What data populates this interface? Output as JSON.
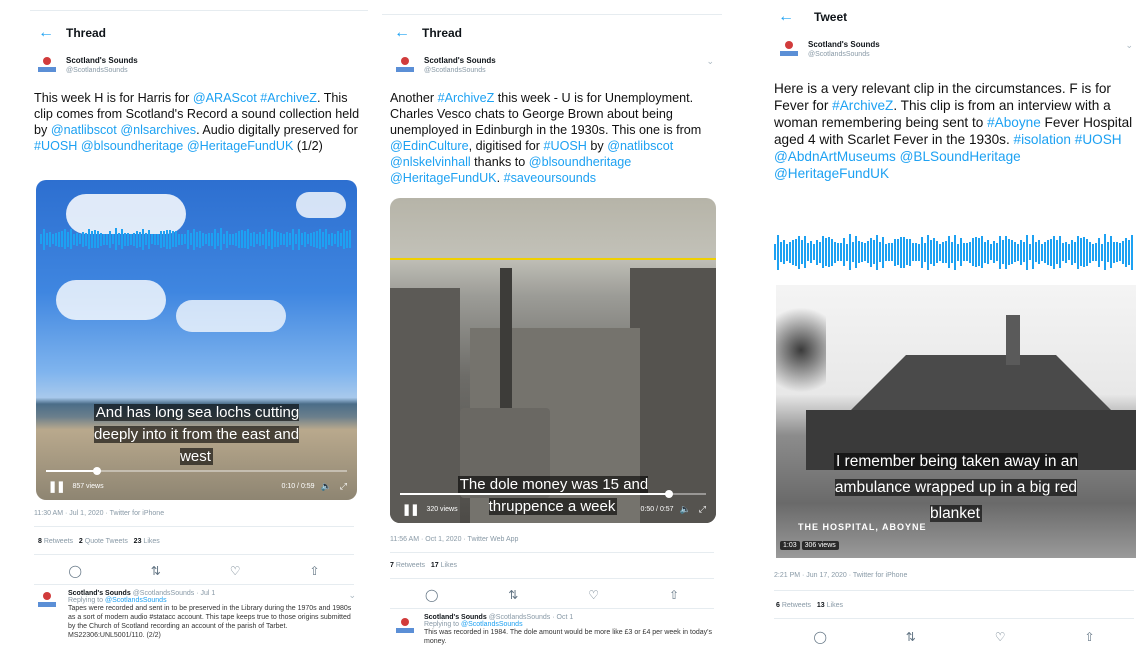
{
  "panels": [
    {
      "header": "Thread",
      "author": {
        "name": "Scotland's Sounds",
        "handle": "@ScotlandsSounds"
      },
      "tweet": {
        "parts": [
          {
            "t": "This week H is for Harris for "
          },
          {
            "t": "@ARAScot",
            "link": true
          },
          {
            "t": " "
          },
          {
            "t": "#ArchiveZ",
            "link": true
          },
          {
            "t": ".  This clip comes from Scotland's Record a sound collection held by "
          },
          {
            "t": "@natlibscot",
            "link": true
          },
          {
            "t": " "
          },
          {
            "t": "@nlsarchives",
            "link": true
          },
          {
            "t": ". Audio digitally preserved for "
          },
          {
            "t": "#UOSH",
            "link": true
          },
          {
            "t": " "
          },
          {
            "t": "@blsoundheritage",
            "link": true
          },
          {
            "t": " "
          },
          {
            "t": "@HeritageFundUK",
            "link": true
          },
          {
            "t": " (1/2)"
          }
        ]
      },
      "video": {
        "subtitle": "And has long sea lochs cutting deeply into it from the east and west",
        "views": "857 views",
        "time": "0:10 / 0:59",
        "progress": 0.17
      },
      "meta": "11:30 AM · Jul 1, 2020 · Twitter for iPhone",
      "stats": [
        {
          "num": "8",
          "label": "Retweets"
        },
        {
          "num": "2",
          "label": "Quote Tweets"
        },
        {
          "num": "23",
          "label": "Likes"
        }
      ],
      "reply": {
        "name": "Scotland's Sounds",
        "handle": "@ScotlandsSounds · Jul 1",
        "replying_to_label": "Replying to",
        "replying_to": "@ScotlandsSounds",
        "text": "Tapes were recorded and sent in to be preserved in the Library during the 1970s and 1980s as a sort of modern audio #statacc account. This tape keeps true to those origins submitted by the Church of Scotland recording an account of the parish of Tarbet. MS22306:UNL5001/110. (2/2)"
      }
    },
    {
      "header": "Thread",
      "author": {
        "name": "Scotland's Sounds",
        "handle": "@ScotlandsSounds"
      },
      "tweet": {
        "parts": [
          {
            "t": "Another "
          },
          {
            "t": "#ArchiveZ",
            "link": true
          },
          {
            "t": " this week - U is for Unemployment. Charles Vesco chats to George Brown about being unemployed in Edinburgh in the 1930s. This one is from "
          },
          {
            "t": "@EdinCulture",
            "link": true
          },
          {
            "t": ",  digitised for "
          },
          {
            "t": "#UOSH",
            "link": true
          },
          {
            "t": " by "
          },
          {
            "t": "@natlibscot",
            "link": true
          },
          {
            "t": " "
          },
          {
            "t": "@nlskelvinhall",
            "link": true
          },
          {
            "t": " thanks to "
          },
          {
            "t": "@blsoundheritage",
            "link": true
          },
          {
            "t": " "
          },
          {
            "t": "@HeritageFundUK",
            "link": true
          },
          {
            "t": ". "
          },
          {
            "t": "#saveoursounds",
            "link": true
          }
        ]
      },
      "video": {
        "subtitle": "The dole money was 15 and thruppence a week",
        "views": "320 views",
        "time": "0:50 / 0:57",
        "progress": 0.88
      },
      "meta": "11:56 AM · Oct 1, 2020 · Twitter Web App",
      "stats": [
        {
          "num": "7",
          "label": "Retweets"
        },
        {
          "num": "17",
          "label": "Likes"
        }
      ],
      "reply": {
        "name": "Scotland's Sounds",
        "handle": "@ScotlandsSounds · Oct 1",
        "replying_to_label": "Replying to",
        "replying_to": "@ScotlandsSounds",
        "text": "This was recorded in 1984. The dole amount would be more like £3 or £4 per week in today's money."
      }
    },
    {
      "header": "Tweet",
      "author": {
        "name": "Scotland's Sounds",
        "handle": "@ScotlandsSounds"
      },
      "tweet": {
        "parts": [
          {
            "t": "Here is a very relevant clip in the circumstances. F is for Fever for "
          },
          {
            "t": "#ArchiveZ",
            "link": true
          },
          {
            "t": ". This clip is from an interview with a woman remembering being sent to "
          },
          {
            "t": "#Aboyne",
            "link": true
          },
          {
            "t": " Fever Hospital aged 4 with Scarlet Fever in the 1930s. "
          },
          {
            "t": "#isolation",
            "link": true
          },
          {
            "t": " "
          },
          {
            "t": "#UOSH",
            "link": true
          },
          {
            "t": " "
          },
          {
            "t": "@AbdnArtMuseums",
            "link": true
          },
          {
            "t": " "
          },
          {
            "t": "@BLSoundHeritage",
            "link": true
          },
          {
            "t": " "
          },
          {
            "t": "@HeritageFundUK",
            "link": true
          }
        ]
      },
      "video": {
        "subtitle": "I remember being taken away in an ambulance wrapped up in a big red blanket",
        "caption": "THE HOSPITAL, ABOYNE",
        "duration": "1:03",
        "views": "306 views"
      },
      "meta": "2:21 PM · Jun 17, 2020 · Twitter for iPhone",
      "stats": [
        {
          "num": "6",
          "label": "Retweets"
        },
        {
          "num": "13",
          "label": "Likes"
        }
      ]
    }
  ],
  "icons": {
    "back": "←",
    "more": "⌄",
    "reply": "◯",
    "retweet": "⇅",
    "like": "♡",
    "share": "⇧",
    "pause": "❚❚",
    "volume": "🔈",
    "fullscreen": "⤢"
  },
  "colors": {
    "link": "#1da1f2",
    "wave": "#1da1f2"
  }
}
